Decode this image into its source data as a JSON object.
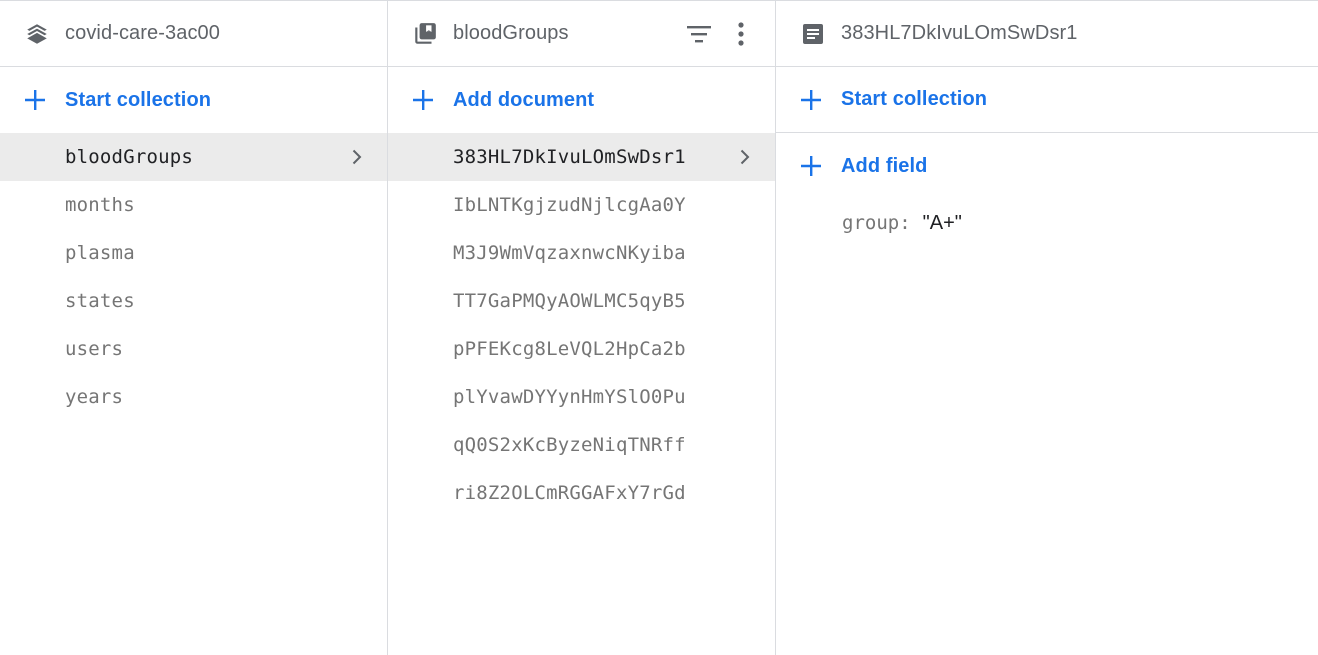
{
  "colors": {
    "accent": "#1a73e8",
    "divider": "#dadce0",
    "selected_bg": "#ebebeb",
    "muted_text": "#757575",
    "header_text": "#5f6368"
  },
  "root_panel": {
    "title": "covid-care-3ac00",
    "icon": "database-stack-icon",
    "action_label": "Start collection",
    "items": [
      {
        "label": "bloodGroups",
        "selected": true
      },
      {
        "label": "months"
      },
      {
        "label": "plasma"
      },
      {
        "label": "states"
      },
      {
        "label": "users"
      },
      {
        "label": "years"
      }
    ]
  },
  "collection_panel": {
    "title": "bloodGroups",
    "icon": "collection-icon",
    "filter_icon": "filter-icon",
    "more_icon": "more-vert-icon",
    "action_label": "Add document",
    "items": [
      {
        "label": "383HL7DkIvuLOmSwDsr1",
        "selected": true
      },
      {
        "label": "IbLNTKgjzudNjlcgAa0Y"
      },
      {
        "label": "M3J9WmVqzaxnwcNKyiba"
      },
      {
        "label": "TT7GaPMQyAOWLMC5qyB5"
      },
      {
        "label": "pPFEKcg8LeVQL2HpCa2b"
      },
      {
        "label": "plYvawDYYynHmYSlO0Pu"
      },
      {
        "label": "qQ0S2xKcByzeNiqTNRff"
      },
      {
        "label": "ri8Z2OLCmRGGAFxY7rGd"
      }
    ]
  },
  "document_panel": {
    "title": "383HL7DkIvuLOmSwDsr1",
    "icon": "document-icon",
    "start_collection_label": "Start collection",
    "add_field_label": "Add field",
    "fields": [
      {
        "key": "group",
        "separator": ":",
        "value": "\"A+\""
      }
    ]
  }
}
